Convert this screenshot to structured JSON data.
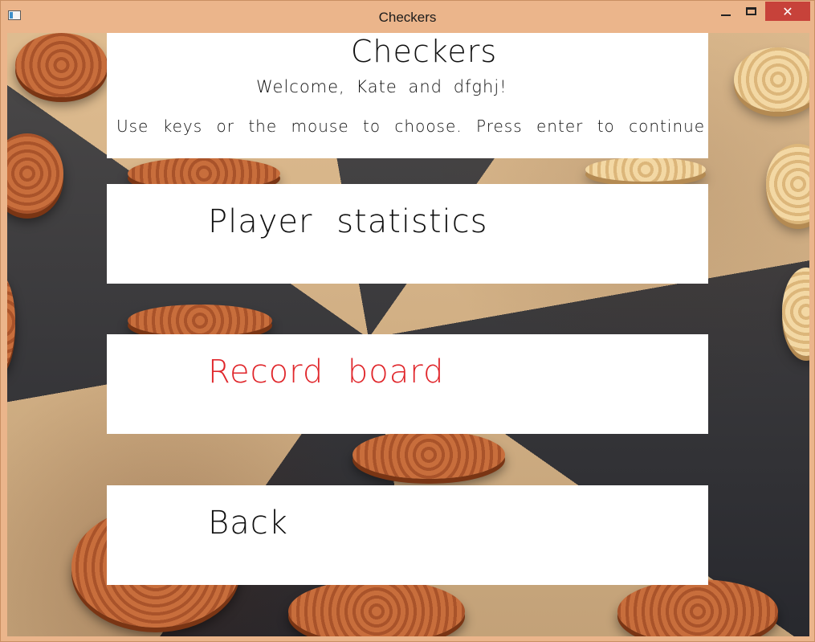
{
  "window": {
    "title": "Checkers",
    "close_glyph": "✕"
  },
  "header": {
    "title": "Checkers",
    "welcome": "Welcome, Kate and dfghj!",
    "hint": "Use keys or the mouse to choose. Press enter to continue"
  },
  "menu": {
    "items": [
      {
        "label": "Player statistics",
        "selected": false
      },
      {
        "label": "Record board",
        "selected": true
      },
      {
        "label": "Back",
        "selected": false
      }
    ]
  },
  "colors": {
    "selected": "#e0262b",
    "normal": "#111111",
    "panel": "#ffffff",
    "frame": "#ebb58b"
  },
  "icons": [
    "app-icon",
    "minimize-icon",
    "maximize-icon",
    "close-icon"
  ]
}
